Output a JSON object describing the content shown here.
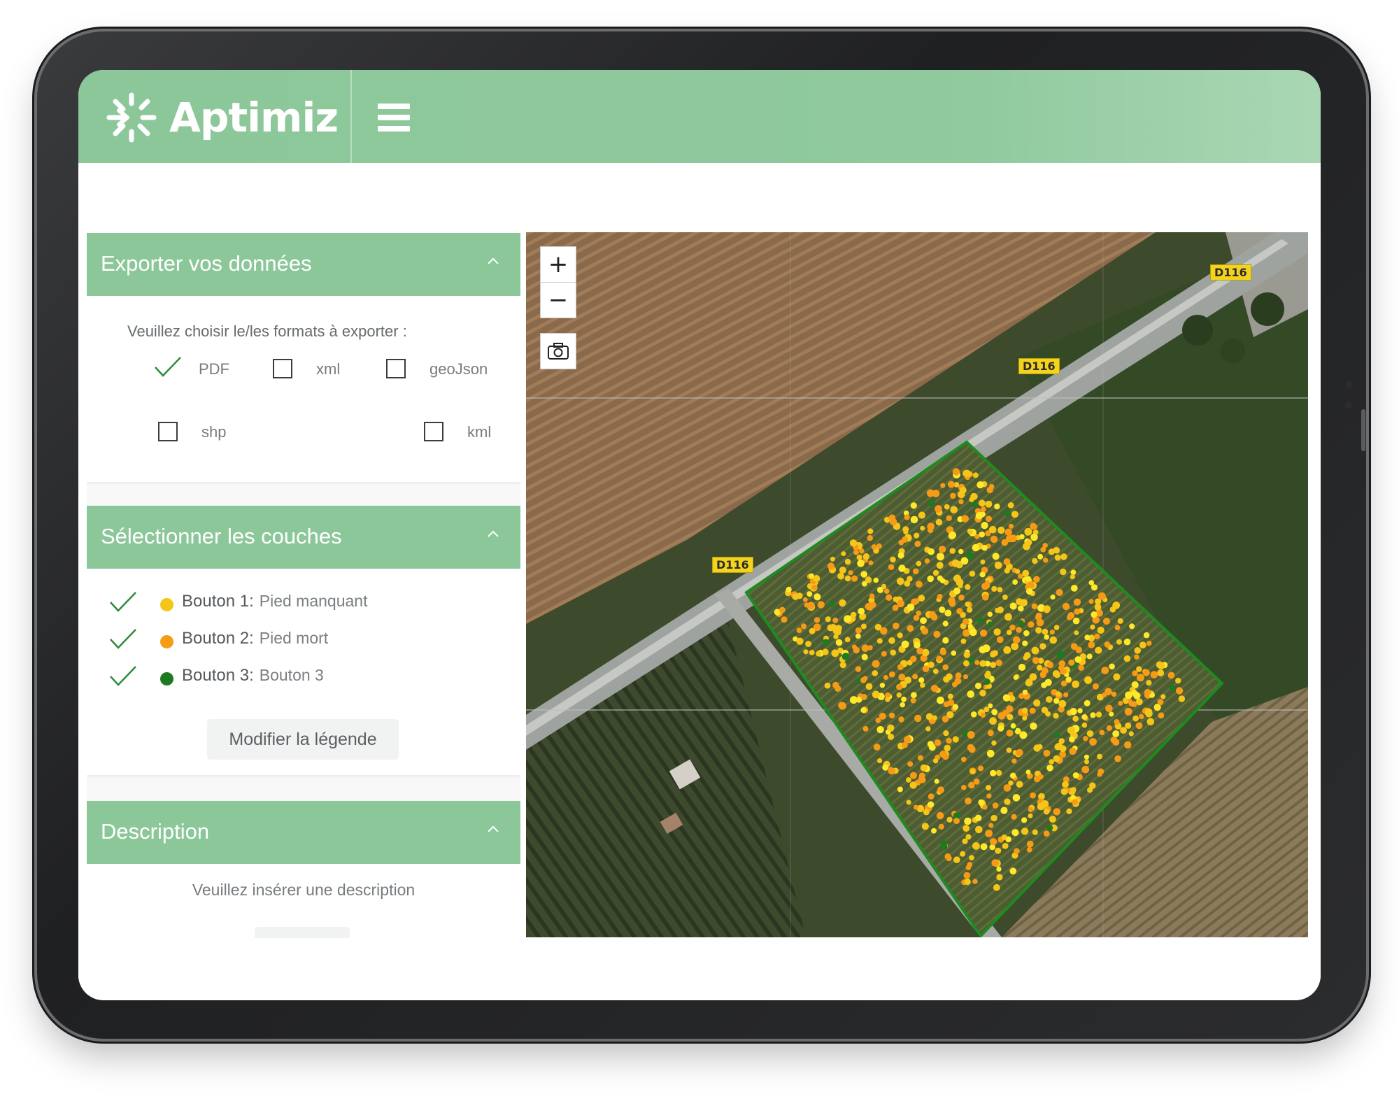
{
  "app": {
    "name": "Aptimiz"
  },
  "colors": {
    "brand": "#8cc79a",
    "layer1": "#f5c518",
    "layer2": "#f59b16",
    "layer3": "#1d7a1f"
  },
  "export": {
    "title": "Exporter vos données",
    "prompt": "Veuillez choisir le/les formats à exporter :",
    "formats": [
      {
        "label": "PDF",
        "checked": true
      },
      {
        "label": "xml",
        "checked": false
      },
      {
        "label": "geoJson",
        "checked": false
      },
      {
        "label": "shp",
        "checked": false
      },
      {
        "label": "kml",
        "checked": false
      }
    ]
  },
  "layers": {
    "title": "Sélectionner les couches",
    "items": [
      {
        "name": "Bouton 1:",
        "desc": "Pied manquant",
        "color": "#f5c518",
        "checked": true
      },
      {
        "name": "Bouton 2:",
        "desc": "Pied mort",
        "color": "#f59b16",
        "checked": true
      },
      {
        "name": "Bouton 3:",
        "desc": "Bouton 3",
        "color": "#1d7a1f",
        "checked": true
      }
    ],
    "legend_button": "Modifier la légende"
  },
  "description": {
    "title": "Description",
    "placeholder": "Veuillez insérer une description"
  },
  "map": {
    "zoom_in": "+",
    "zoom_out": "−",
    "road_label": "D116"
  }
}
